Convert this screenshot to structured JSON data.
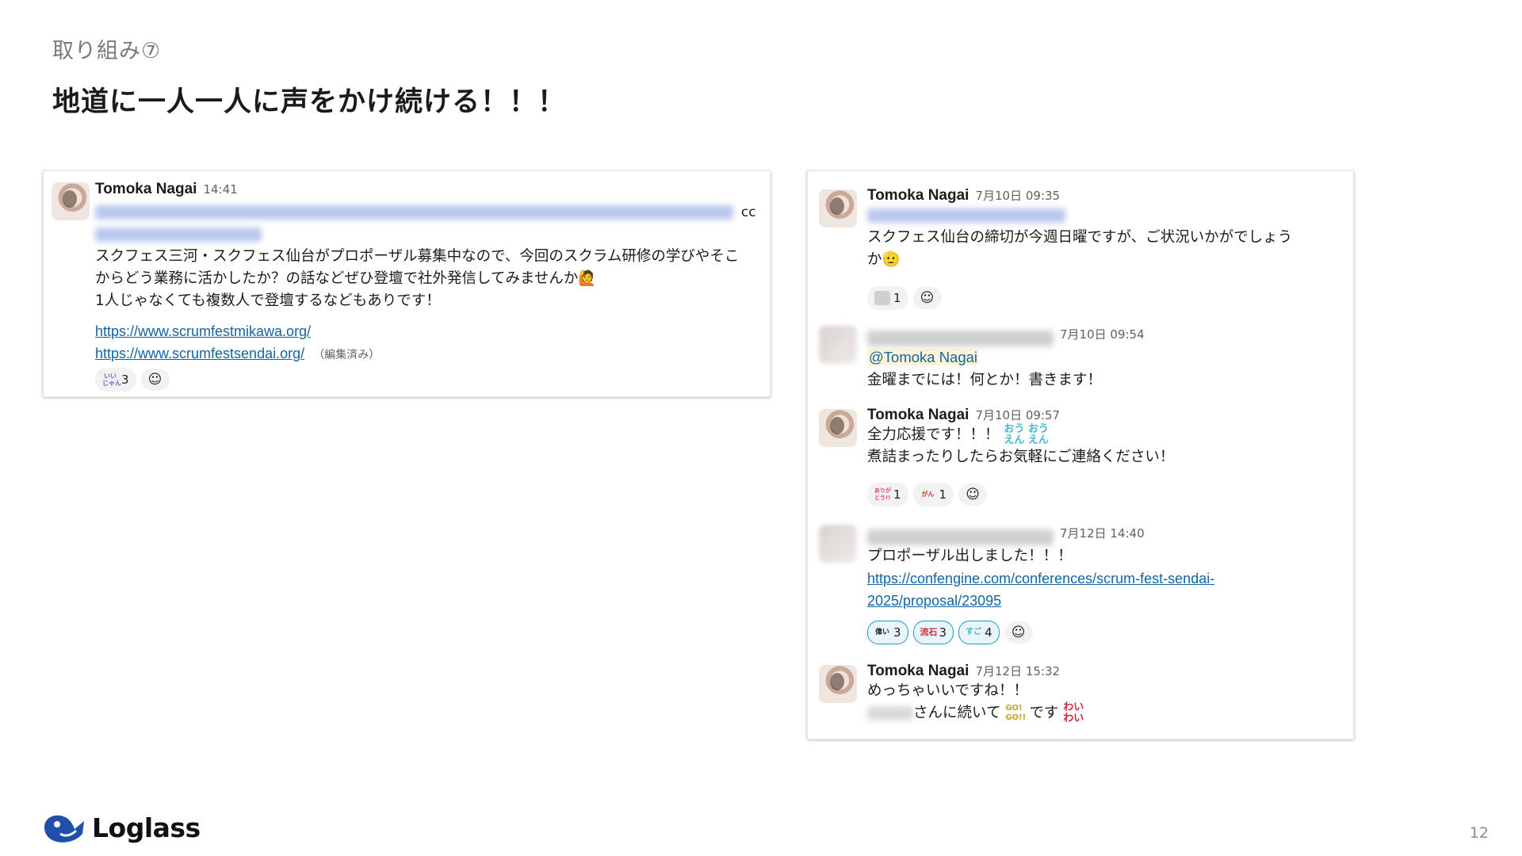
{
  "slide": {
    "section_label": "取り組み⑦",
    "title": "地道に一人一人に声をかけ続ける！！！",
    "page_number": "12",
    "brand": "Loglass",
    "brand_color": "#1f4fa8"
  },
  "left_message": {
    "author": "Tomoka Nagai",
    "time": "14:41",
    "cc": "cc",
    "lines": [
      "スクフェス三河・スクフェス仙台がプロポーザル募集中なので、今回のスクラム研修の学びやそこ",
      "からどう業務に活かしたか？の話などぜひ登壇で社外発信してみませんか🙋",
      "1人じゃなくても複数人で登壇するなどもありです！"
    ],
    "links": [
      "https://www.scrumfestmikawa.org/",
      "https://www.scrumfestsendai.org/"
    ],
    "edited": "（編集済み）",
    "reactions": [
      {
        "emoji": "いいじゃん",
        "count": "3"
      }
    ],
    "add_reaction_icon": "add-reaction"
  },
  "right_messages": [
    {
      "author": "Tomoka Nagai",
      "time": "7月10日 09:35",
      "lines": [
        "スクフェス仙台の締切が今週日曜ですが、ご状況いかがでしょう",
        "か🫡"
      ],
      "reactions": [
        {
          "emoji": "person",
          "count": "1"
        }
      ]
    },
    {
      "author": "",
      "time": "7月10日 09:54",
      "mention": "@Tomoka Nagai",
      "lines": [
        "金曜までには！何とか！書きます！"
      ]
    },
    {
      "author": "Tomoka Nagai",
      "time": "7月10日 09:57",
      "lines": [
        "全力応援です！！！",
        "煮詰まったりしたらお気軽にご連絡ください！"
      ],
      "inline_emoji": "おうえん",
      "reactions": [
        {
          "emoji": "ありがとう",
          "count": "1"
        },
        {
          "emoji": "がんばる",
          "count": "1"
        }
      ]
    },
    {
      "author": "",
      "time": "7月12日 14:40",
      "lines": [
        "プロポーザル出しました！！！"
      ],
      "link_lines": [
        "https://confengine.com/conferences/scrum-fest-sendai-",
        "2025/proposal/23095"
      ],
      "reactions": [
        {
          "emoji": "偉い",
          "count": "3"
        },
        {
          "emoji": "流石",
          "count": "3"
        },
        {
          "emoji": "すごい",
          "count": "4"
        }
      ]
    },
    {
      "author": "Tomoka Nagai",
      "time": "7月12日 15:32",
      "lines": [
        "めっちゃいいですね！！",
        "さんに続いて",
        "です"
      ],
      "emoji_go": "GO! GO!!",
      "emoji_wai": "わい わい"
    }
  ]
}
